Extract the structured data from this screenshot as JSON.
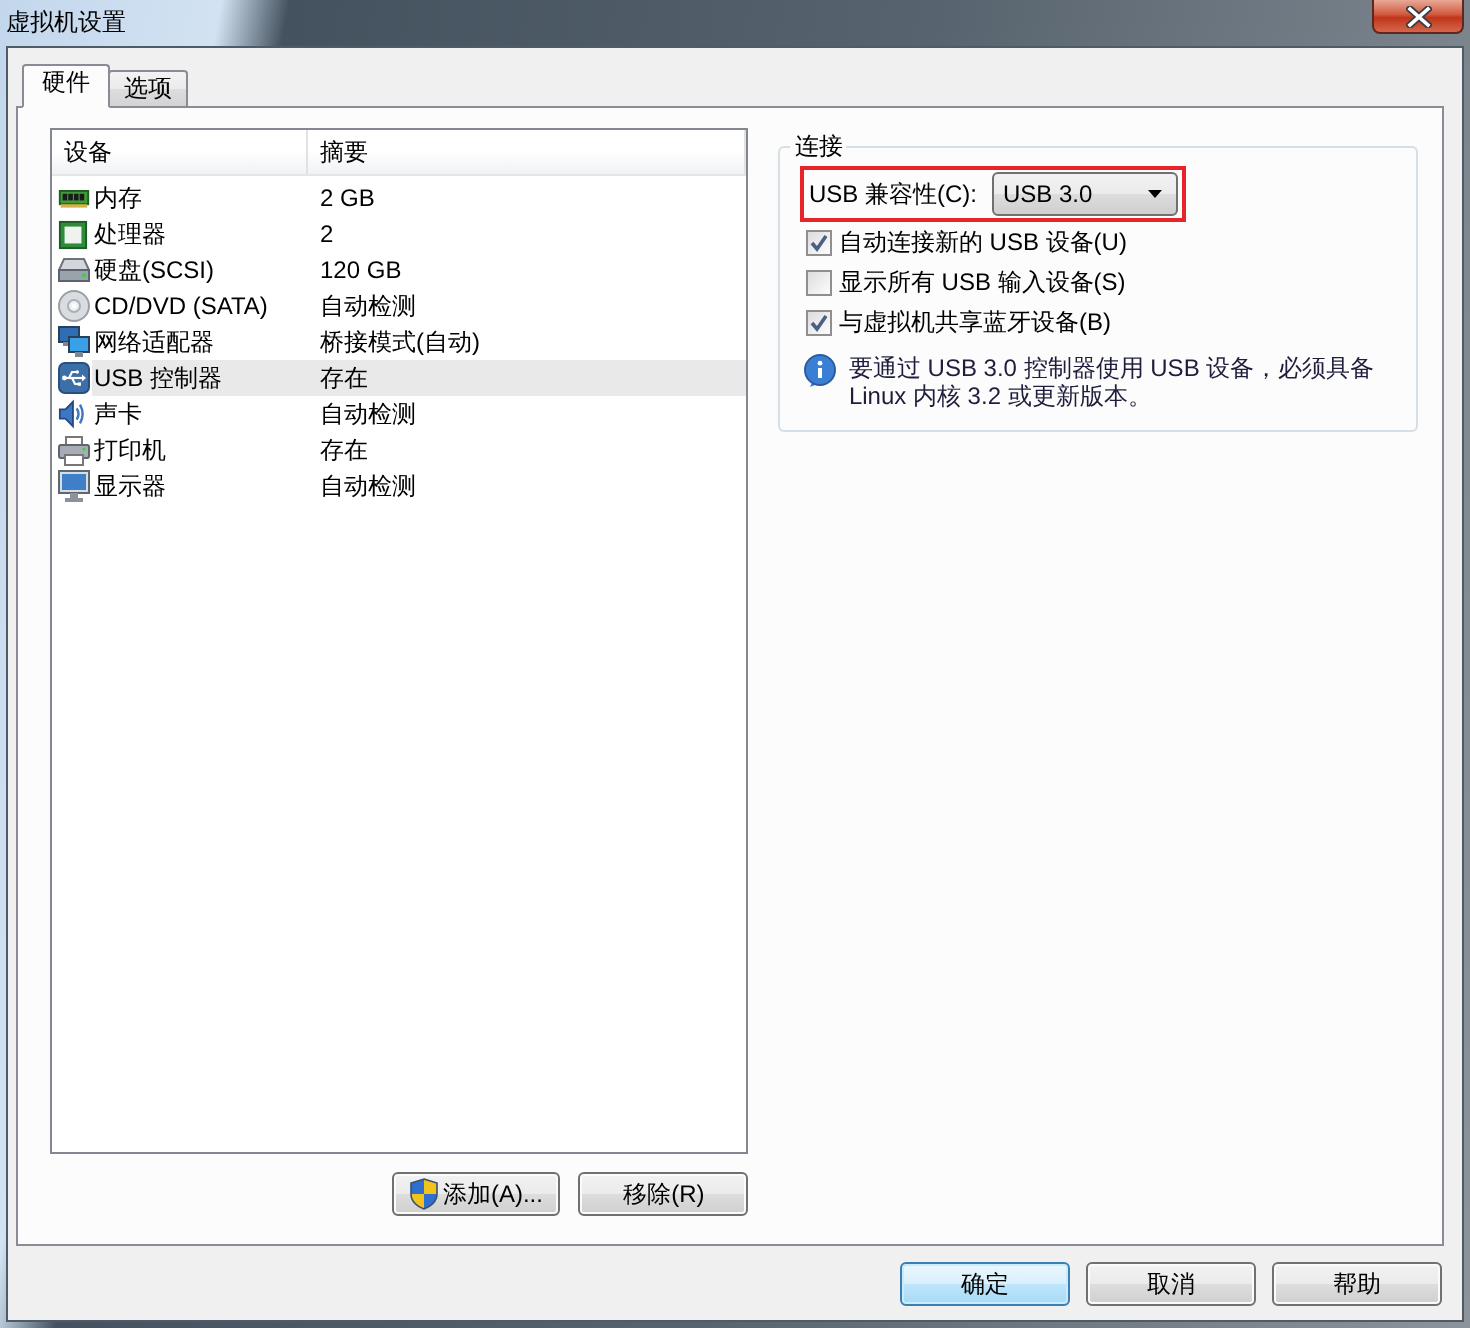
{
  "window": {
    "title": "虚拟机设置"
  },
  "tabs": [
    {
      "label": "硬件",
      "selected": true
    },
    {
      "label": "选项",
      "selected": false
    }
  ],
  "device_list": {
    "columns": [
      "设备",
      "摘要"
    ],
    "rows": [
      {
        "kind": "memory",
        "device": "内存",
        "summary": "2 GB",
        "selected": false
      },
      {
        "kind": "processor",
        "device": "处理器",
        "summary": "2",
        "selected": false
      },
      {
        "kind": "disk",
        "device": "硬盘(SCSI)",
        "summary": "120 GB",
        "selected": false
      },
      {
        "kind": "optical",
        "device": "CD/DVD (SATA)",
        "summary": "自动检测",
        "selected": false
      },
      {
        "kind": "network",
        "device": "网络适配器",
        "summary": "桥接模式(自动)",
        "selected": false
      },
      {
        "kind": "usb",
        "device": "USB 控制器",
        "summary": "存在",
        "selected": true
      },
      {
        "kind": "sound",
        "device": "声卡",
        "summary": "自动检测",
        "selected": false
      },
      {
        "kind": "printer",
        "device": "打印机",
        "summary": "存在",
        "selected": false
      },
      {
        "kind": "display",
        "device": "显示器",
        "summary": "自动检测",
        "selected": false
      }
    ]
  },
  "device_buttons": [
    {
      "label": "添加(A)...",
      "kind": "shield"
    },
    {
      "label": "移除(R)",
      "kind": "plain"
    }
  ],
  "connection": {
    "title": "连接",
    "usb_compatibility": {
      "label": "USB 兼容性(C):",
      "value": "USB 3.0",
      "highlighted": true
    },
    "options": [
      {
        "label": "自动连接新的 USB 设备(U)",
        "checked": true
      },
      {
        "label": "显示所有 USB 输入设备(S)",
        "checked": false
      },
      {
        "label": "与虚拟机共享蓝牙设备(B)",
        "checked": true
      }
    ],
    "note": "要通过 USB 3.0 控制器使用 USB 设备，必须具备 Linux 内核 3.2 或更新版本。"
  },
  "dialog_buttons": [
    {
      "label": "确定",
      "default": true
    },
    {
      "label": "取消",
      "default": false
    },
    {
      "label": "帮助",
      "default": false
    }
  ]
}
